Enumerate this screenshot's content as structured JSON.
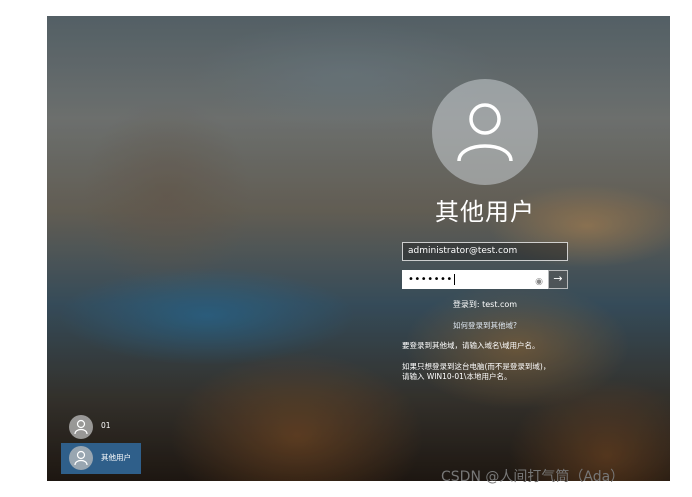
{
  "login": {
    "username": "其他用户",
    "email_value": "administrator@test.com",
    "password_masked": "•••••••",
    "reveal_icon": "eye-icon",
    "submit_glyph": "→",
    "signin_to": "登录到: test.com",
    "how_link": "如何登录到其他域?",
    "info_line1": "要登录到其他域，请输入域名\\域用户名。",
    "info_line2a": "如果只想登录到这台电脑(而不是登录到域)，",
    "info_line2b": "请输入 WIN10-01\\本地用户名。"
  },
  "users": [
    {
      "name": "01",
      "selected": false
    },
    {
      "name": "其他用户",
      "selected": true
    }
  ],
  "watermark": "CSDN @人间打气筒（Ada）",
  "colors": {
    "selected_user_bg": "#2f5f8a",
    "text": "#ffffff"
  }
}
